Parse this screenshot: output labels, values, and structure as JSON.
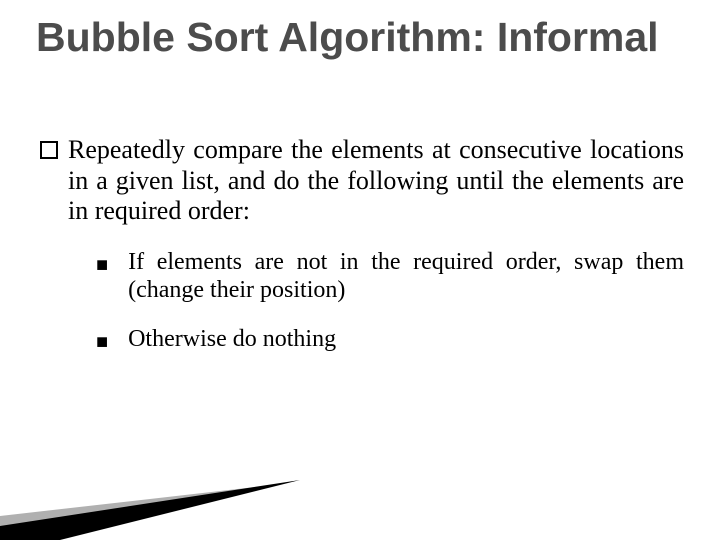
{
  "title": "Bubble Sort Algorithm: Informal",
  "intro": "Repeatedly compare the elements at consecutive locations in a given list, and do the following until the elements are in required order:",
  "points": [
    "If elements are not in the required order, swap them (change their position)",
    "Otherwise do nothing"
  ]
}
